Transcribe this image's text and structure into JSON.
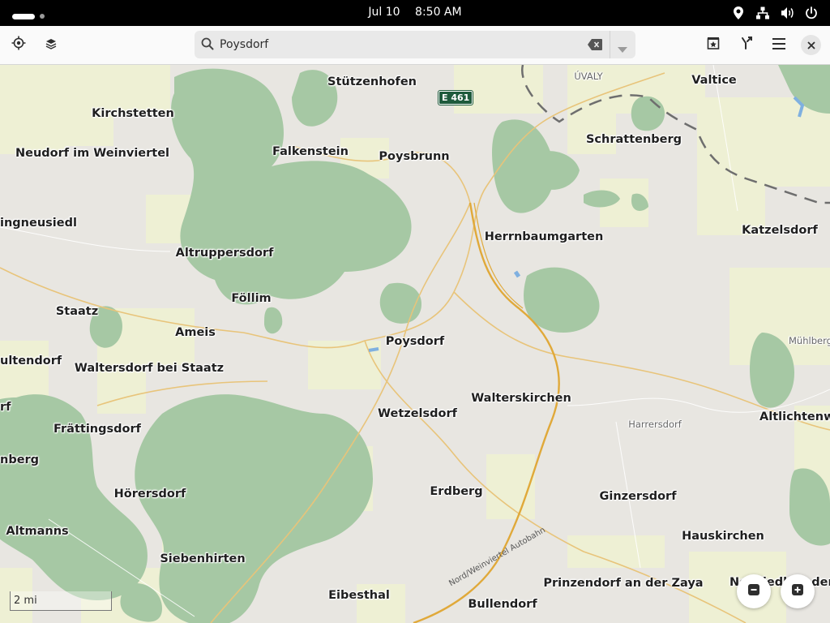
{
  "topbar": {
    "date": "Jul 10",
    "time": "8:50 AM",
    "icons": [
      "location-icon",
      "network-icon",
      "volume-icon",
      "power-icon"
    ]
  },
  "header": {
    "icons": [
      "locate-icon",
      "layers-icon",
      "favorites-icon",
      "route-icon",
      "menu-icon",
      "close-icon"
    ]
  },
  "search": {
    "value": "Poysdorf",
    "placeholder": ""
  },
  "map": {
    "colors": {
      "land": "#e8e6e1",
      "forest": "#a6c8a4",
      "farmland": "#eef0d4",
      "roads": "#e8c47a",
      "border": "#6e6e6e"
    },
    "places": [
      {
        "name": "Stützenhofen"
      },
      {
        "name": "Valtice"
      },
      {
        "name": "Kirchstetten"
      },
      {
        "name": "Neudorf im Weinviertel"
      },
      {
        "name": "Falkenstein"
      },
      {
        "name": "Poysbrunn"
      },
      {
        "name": "Schrattenberg"
      },
      {
        "name": "ingneusiedl"
      },
      {
        "name": "Herrnbaumgarten"
      },
      {
        "name": "Katzelsdorf"
      },
      {
        "name": "Altruppersdorf"
      },
      {
        "name": "Föllim"
      },
      {
        "name": "Staatz"
      },
      {
        "name": "Ameis"
      },
      {
        "name": "Poysdorf"
      },
      {
        "name": "ultendorf"
      },
      {
        "name": "Waltersdorf bei Staatz"
      },
      {
        "name": "Walterskirchen"
      },
      {
        "name": "Wetzelsdorf"
      },
      {
        "name": "Altlichtenwa"
      },
      {
        "name": "rf"
      },
      {
        "name": "Frättingsdorf"
      },
      {
        "name": "nberg"
      },
      {
        "name": "Erdberg"
      },
      {
        "name": "Hörersdorf"
      },
      {
        "name": "Ginzersdorf"
      },
      {
        "name": "Altmanns"
      },
      {
        "name": "Hauskirchen"
      },
      {
        "name": "Siebenhirten"
      },
      {
        "name": "Prinzendorf an der Zaya"
      },
      {
        "name": "Eibesthal"
      },
      {
        "name": "Bullendorf"
      },
      {
        "name": "Neusiedl an der Z"
      }
    ],
    "small_places": [
      {
        "name": "ÚVALY"
      },
      {
        "name": "Harrersdorf"
      },
      {
        "name": "Mühlberg"
      }
    ],
    "road_shield": "E 461",
    "road_name": "Nord/Weinviertel Autobahn",
    "scale_label": "2 mi"
  },
  "zoom": {
    "icons": [
      "zoom-out-icon",
      "zoom-in-icon"
    ]
  }
}
